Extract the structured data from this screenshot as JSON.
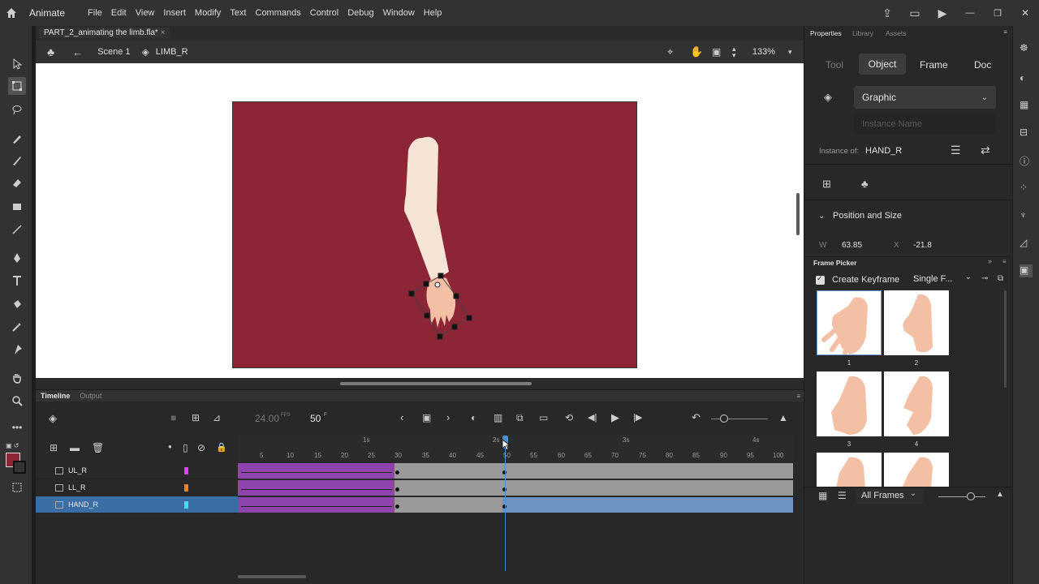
{
  "app": {
    "name": "Animate"
  },
  "menu": [
    "File",
    "Edit",
    "View",
    "Insert",
    "Modify",
    "Text",
    "Commands",
    "Control",
    "Debug",
    "Window",
    "Help"
  ],
  "document": {
    "tab": "PART_2_animating the limb.fla*",
    "scene": "Scene 1",
    "symbol": "LIMB_R",
    "zoom": "133%"
  },
  "timeline": {
    "tab": "Timeline",
    "output_tab": "Output",
    "fps": "24.00",
    "fps_unit": "FPS",
    "frame": "50",
    "frame_unit": "F",
    "seconds": [
      "1s",
      "2s",
      "3s",
      "4s"
    ],
    "frame_ticks": [
      "5",
      "10",
      "15",
      "20",
      "25",
      "30",
      "35",
      "40",
      "45",
      "50",
      "55",
      "60",
      "65",
      "70",
      "75",
      "80",
      "85",
      "90",
      "95",
      "100"
    ],
    "layers": [
      {
        "name": "UL_R",
        "color": "#e040fb"
      },
      {
        "name": "LL_R",
        "color": "#f08020"
      },
      {
        "name": "HAND_R",
        "color": "#40e0f0"
      }
    ],
    "selected_layer": "HAND_R"
  },
  "properties": {
    "tabs": [
      "Properties",
      "Library",
      "Assets"
    ],
    "subtabs": [
      "Tool",
      "Object",
      "Frame",
      "Doc"
    ],
    "active_subtab": "Object",
    "symbol_type": "Graphic",
    "instance_name_placeholder": "Instance Name",
    "instance_of_label": "Instance of:",
    "instance_of": "HAND_R",
    "section": "Position and Size",
    "w_label": "W",
    "w_value": "63.85",
    "x_label": "X",
    "x_value": "-21.8"
  },
  "frame_picker": {
    "title": "Frame Picker",
    "create_keyframe": "Create Keyframe",
    "mode": "Single F...",
    "thumbs": [
      "1",
      "2",
      "3",
      "4"
    ],
    "filter": "All Frames"
  },
  "colors": {
    "stage": "#8c2535",
    "selection": "#3a6ea5",
    "tween": "#8e44ad",
    "playhead": "#4a8fd4",
    "skin": "#f3c0a6",
    "arm": "#f6e4d6"
  }
}
